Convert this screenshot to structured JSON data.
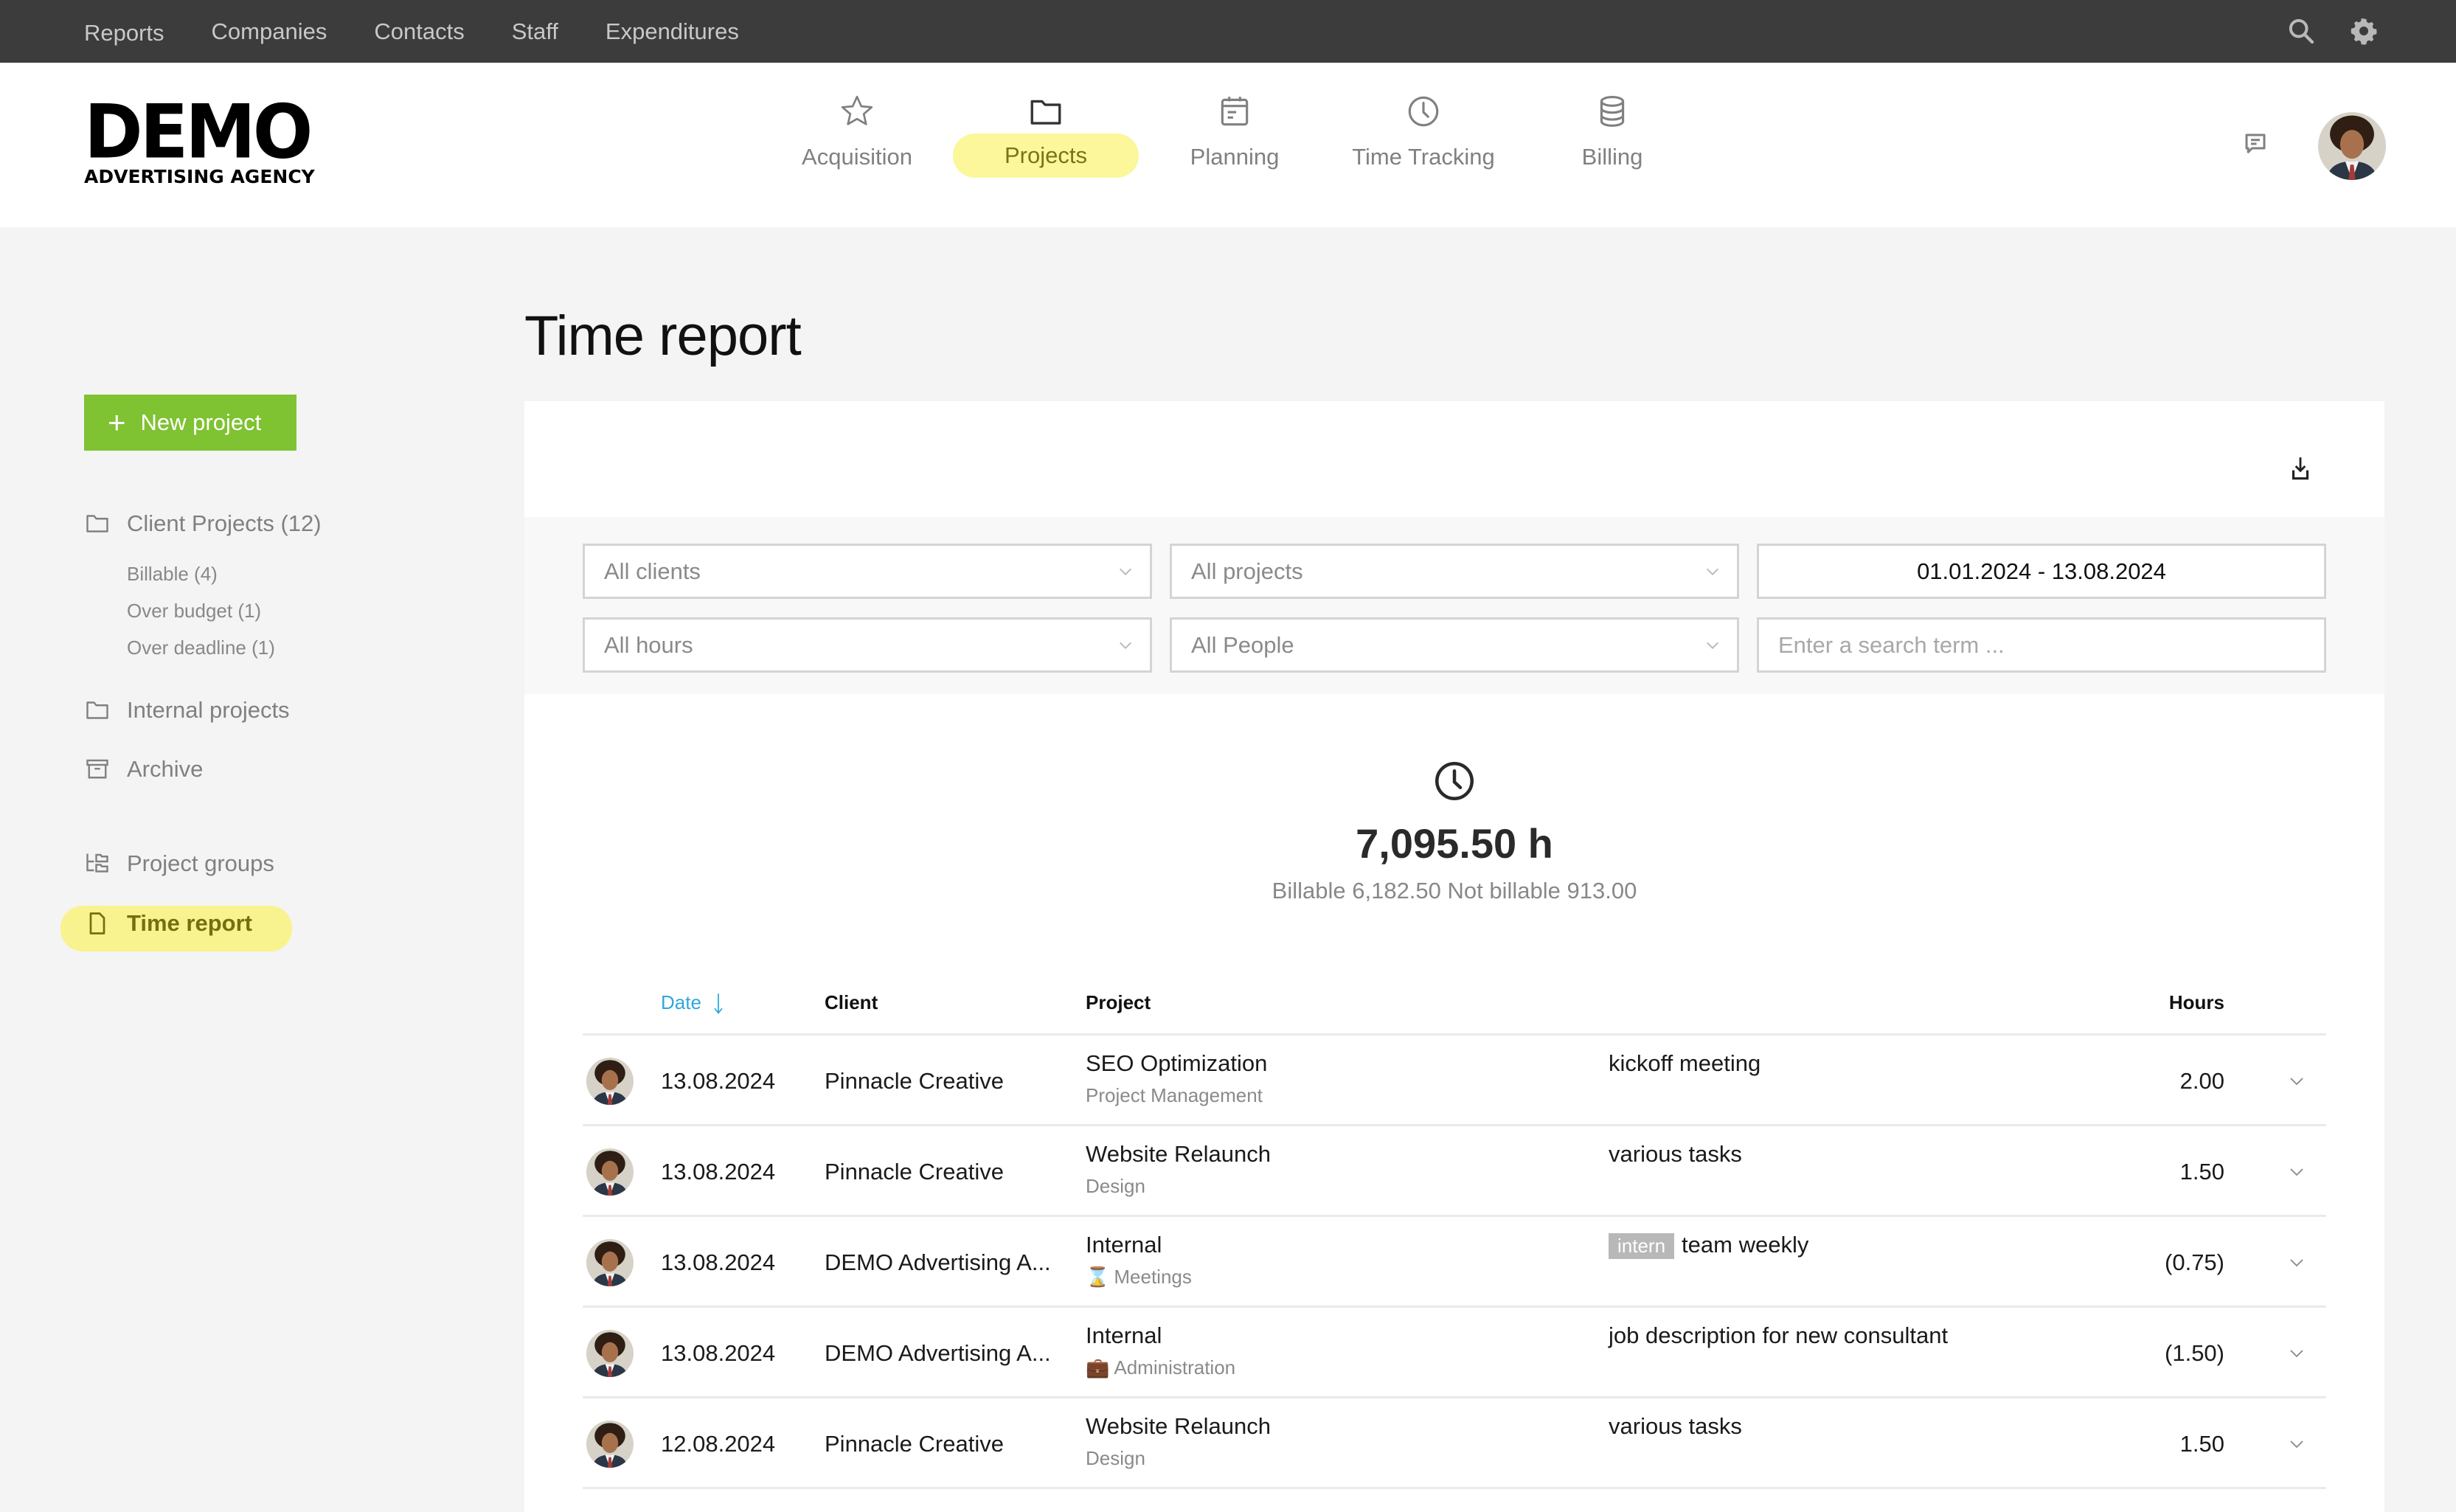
{
  "topbar": {
    "nav": [
      "Reports",
      "Companies",
      "Contacts",
      "Staff",
      "Expenditures"
    ],
    "icons": [
      "search-icon",
      "gear-icon"
    ]
  },
  "header": {
    "logo": {
      "main": "DEMO",
      "sub": "ADVERTISING AGENCY"
    },
    "nav": [
      {
        "label": "Acquisition",
        "icon": "star-icon",
        "active": false
      },
      {
        "label": "Projects",
        "icon": "folder-icon",
        "active": true
      },
      {
        "label": "Planning",
        "icon": "calendar-icon",
        "active": false
      },
      {
        "label": "Time Tracking",
        "icon": "clock-icon",
        "active": false
      },
      {
        "label": "Billing",
        "icon": "database-icon",
        "active": false
      }
    ],
    "highlight_color": "#fbf79a"
  },
  "sidebar": {
    "new_button": "New project",
    "new_button_color": "#7fc232",
    "client_projects": "Client Projects (12)",
    "sub_items": [
      "Billable (4)",
      "Over budget (1)",
      "Over deadline (1)"
    ],
    "internal_projects": "Internal projects",
    "archive": "Archive",
    "project_groups": "Project groups",
    "time_report": "Time report"
  },
  "page": {
    "title": "Time report"
  },
  "filters": {
    "clients": "All clients",
    "projects": "All projects",
    "date_range": "01.01.2024 - 13.08.2024",
    "hours": "All hours",
    "people": "All People",
    "search_placeholder": "Enter a search term ..."
  },
  "summary": {
    "total": "7,095.50 h",
    "breakdown": "Billable 6,182.50 Not billable 913.00"
  },
  "table": {
    "headers": {
      "date": "Date",
      "client": "Client",
      "project": "Project",
      "hours": "Hours"
    },
    "sort_color": "#2fa7dc",
    "rows": [
      {
        "date": "13.08.2024",
        "client": "Pinnacle Creative",
        "project": "SEO Optimization",
        "task": "Project Management",
        "task_emoji": "",
        "tag": "",
        "note": "kickoff meeting",
        "hours": "2.00"
      },
      {
        "date": "13.08.2024",
        "client": "Pinnacle Creative",
        "project": "Website Relaunch",
        "task": "Design",
        "task_emoji": "",
        "tag": "",
        "note": "various tasks",
        "hours": "1.50"
      },
      {
        "date": "13.08.2024",
        "client": "DEMO Advertising A...",
        "project": "Internal",
        "task": "Meetings",
        "task_emoji": "⌛",
        "tag": "intern",
        "note": "team weekly",
        "hours": "(0.75)"
      },
      {
        "date": "13.08.2024",
        "client": "DEMO Advertising A...",
        "project": "Internal",
        "task": "Administration",
        "task_emoji": "💼",
        "tag": "",
        "note": "job description for new consultant",
        "hours": "(1.50)"
      },
      {
        "date": "12.08.2024",
        "client": "Pinnacle Creative",
        "project": "Website Relaunch",
        "task": "Design",
        "task_emoji": "",
        "tag": "",
        "note": "various tasks",
        "hours": "1.50"
      }
    ]
  }
}
